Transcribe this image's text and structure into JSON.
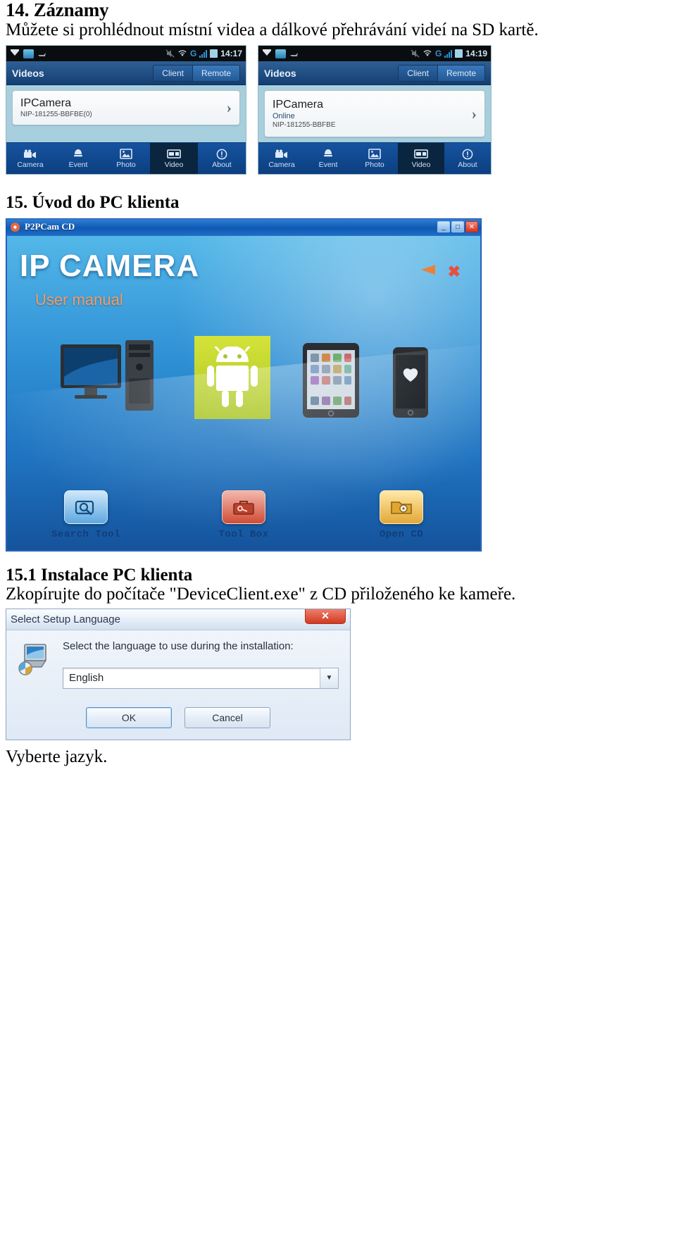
{
  "document": {
    "section14_heading": "14. Záznamy",
    "section14_text": "Můžete si prohlédnout místní videa a dálkové přehrávání videí na SD kartě.",
    "section15_heading": "15. Úvod do PC klienta",
    "section15_1_heading": "15.1 Instalace PC klienta",
    "section15_1_text": "Zkopírujte do počítače \"DeviceClient.exe\" z CD přiloženého ke kameře.",
    "closing_text": "Vyberte jazyk."
  },
  "phone_left": {
    "statusbar": {
      "time": "14:17",
      "network": "G",
      "icons": [
        "download-icon",
        "picture-icon",
        "sync-icon",
        "mute-icon",
        "wifi-icon",
        "signal-icon",
        "battery-icon"
      ]
    },
    "appbar": {
      "title": "Videos",
      "tabs": [
        {
          "label": "Client",
          "selected": false
        },
        {
          "label": "Remote",
          "selected": true
        }
      ]
    },
    "camera": {
      "name": "IPCamera",
      "status": "",
      "uid": "NIP-181255-BBFBE(0)",
      "chevron": "›"
    },
    "tabbar": [
      {
        "label": "Camera",
        "icon": "camcorder-icon",
        "active": false
      },
      {
        "label": "Event",
        "icon": "bell-icon",
        "active": false
      },
      {
        "label": "Photo",
        "icon": "photo-icon",
        "active": false
      },
      {
        "label": "Video",
        "icon": "film-icon",
        "active": true
      },
      {
        "label": "About",
        "icon": "info-icon",
        "active": false
      }
    ]
  },
  "phone_right": {
    "statusbar": {
      "time": "14:19",
      "network": "G",
      "icons": [
        "download-icon",
        "picture-icon",
        "sync-icon",
        "mute-icon",
        "wifi-icon",
        "signal-icon",
        "battery-icon"
      ]
    },
    "appbar": {
      "title": "Videos",
      "tabs": [
        {
          "label": "Client",
          "selected": false
        },
        {
          "label": "Remote",
          "selected": true
        }
      ]
    },
    "camera": {
      "name": "IPCamera",
      "status": "Online",
      "uid": "NIP-181255-BBFBE",
      "chevron": "›"
    },
    "tabbar": [
      {
        "label": "Camera",
        "icon": "camcorder-icon",
        "active": false
      },
      {
        "label": "Event",
        "icon": "bell-icon",
        "active": false
      },
      {
        "label": "Photo",
        "icon": "photo-icon",
        "active": false
      },
      {
        "label": "Video",
        "icon": "film-icon",
        "active": true
      },
      {
        "label": "About",
        "icon": "info-icon",
        "active": false
      }
    ]
  },
  "cd_window": {
    "title": "P2PCam CD",
    "window_buttons": {
      "minimize": "_",
      "maximize": "□",
      "close": "✕"
    },
    "brand": "IP CAMERA",
    "brand_ip": "IP",
    "brand_camera": "CAMERA",
    "subtitle": "User manual",
    "actions": [
      {
        "label": "Search Tool",
        "icon": "search-tool-icon"
      },
      {
        "label": "Tool Box",
        "icon": "toolbox-icon"
      },
      {
        "label": "Open CD",
        "icon": "folder-icon"
      }
    ],
    "devices": [
      "pc-monitor-icon",
      "android-robot-icon",
      "tablet-icon",
      "smartphone-icon"
    ]
  },
  "setup_dialog": {
    "title": "Select Setup Language",
    "close_label": "✕",
    "prompt": "Select the language to use during the installation:",
    "language_value": "English",
    "dropdown_arrow": "▼",
    "ok_label": "OK",
    "cancel_label": "Cancel",
    "icon": "setup-computer-icon"
  },
  "colors": {
    "android_green": "#a4c639",
    "cd_blue": "#1f72bf",
    "appbar_blue": "#143f74",
    "tabbar_blue": "#0f4c96",
    "tab_active": "#0a2540",
    "phone_bg": "#a7cfdd",
    "close_red": "#cf3420"
  }
}
